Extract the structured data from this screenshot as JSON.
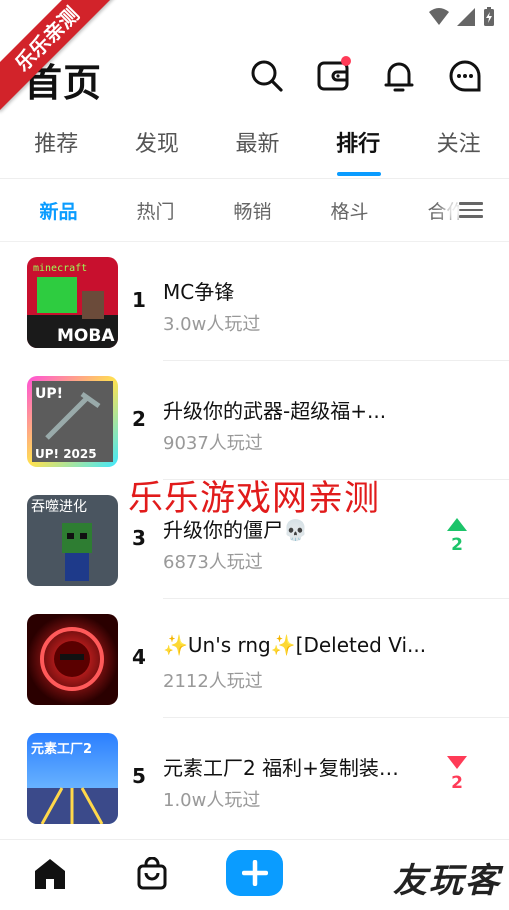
{
  "ribbon": {
    "text": "乐乐亲测"
  },
  "header": {
    "title": "首页"
  },
  "tabs": [
    {
      "label": "推荐",
      "active": false
    },
    {
      "label": "发现",
      "active": false
    },
    {
      "label": "最新",
      "active": false
    },
    {
      "label": "排行",
      "active": true
    },
    {
      "label": "关注",
      "active": false
    }
  ],
  "subtabs": [
    {
      "label": "新品",
      "active": true
    },
    {
      "label": "热门",
      "active": false
    },
    {
      "label": "畅销",
      "active": false
    },
    {
      "label": "格斗",
      "active": false
    },
    {
      "label": "合作",
      "active": false
    }
  ],
  "ranking": [
    {
      "rank": "1",
      "name": "MC争锋",
      "plays": "3.0w人玩过",
      "thumb_text": "MOBA",
      "thumb_colors": [
        "#c8102e",
        "#1a1a1a"
      ],
      "trend": null,
      "trend_value": ""
    },
    {
      "rank": "2",
      "name": "升级你的武器-超级福+...",
      "plays": "9037人玩过",
      "thumb_text": "UP! 2025",
      "thumb_colors": [
        "#ff4fd8",
        "#3ee8ff"
      ],
      "trend": null,
      "trend_value": ""
    },
    {
      "rank": "3",
      "name": "升级你的僵尸💀",
      "plays": "6873人玩过",
      "thumb_text": "吞噬进化",
      "thumb_colors": [
        "#4a5560",
        "#2e7d32"
      ],
      "trend": "up",
      "trend_value": "2"
    },
    {
      "rank": "4",
      "name": "✨Un's rng✨[Deleted Vi...",
      "plays": "2112人玩过",
      "thumb_text": "",
      "thumb_colors": [
        "#b00000",
        "#2a0000"
      ],
      "trend": null,
      "trend_value": ""
    },
    {
      "rank": "5",
      "name": "元素工厂2 福利+复制装…",
      "plays": "1.0w人玩过",
      "thumb_text": "元素工厂2",
      "thumb_colors": [
        "#2b7fff",
        "#8fd3ff"
      ],
      "trend": "down",
      "trend_value": "2"
    }
  ],
  "watermark": {
    "text": "乐乐游戏网亲测"
  },
  "bottom_logo": {
    "text": "友玩客"
  },
  "colors": {
    "accent": "#0a9cff",
    "up": "#1cc46a",
    "down": "#ff3b57",
    "ribbon": "#d2232a"
  }
}
